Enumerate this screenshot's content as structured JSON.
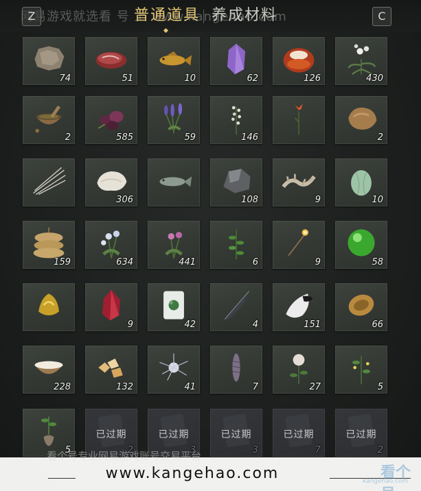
{
  "header": {
    "left_key": "Z",
    "right_key": "C",
    "tabs": [
      {
        "label": "普通道具",
        "active": true
      },
      {
        "label": "养成材料",
        "active": false
      }
    ],
    "watermark": "网易游戏就选看 号 上 www.kangehao.com"
  },
  "inventory": {
    "columns": 6,
    "items": [
      {
        "icon": "animal-hide-icon",
        "count": "74"
      },
      {
        "icon": "raw-meat-icon",
        "count": "51"
      },
      {
        "icon": "golden-carp-icon",
        "count": "10"
      },
      {
        "icon": "amethyst-crystal-icon",
        "count": "62"
      },
      {
        "icon": "red-agate-stone-icon",
        "count": "126"
      },
      {
        "icon": "white-orchid-icon",
        "count": "430"
      },
      {
        "icon": "mortar-and-pestle-icon",
        "count": "2"
      },
      {
        "icon": "purple-flower-bundle-icon",
        "count": "585"
      },
      {
        "icon": "lavender-herb-icon",
        "count": "59"
      },
      {
        "icon": "white-blossom-herb-icon",
        "count": "146"
      },
      {
        "icon": "red-lily-icon",
        "count": ""
      },
      {
        "icon": "fox-fur-icon",
        "count": "2"
      },
      {
        "icon": "porcupine-quills-icon",
        "count": ""
      },
      {
        "icon": "white-fleece-icon",
        "count": "306"
      },
      {
        "icon": "fish-icon",
        "count": ""
      },
      {
        "icon": "iron-ore-icon",
        "count": "108"
      },
      {
        "icon": "bone-fragment-icon",
        "count": "9"
      },
      {
        "icon": "winter-melon-icon",
        "count": "10"
      },
      {
        "icon": "grain-sacks-icon",
        "count": "159"
      },
      {
        "icon": "blue-aster-herb-icon",
        "count": "634"
      },
      {
        "icon": "pink-flower-herb-icon",
        "count": "441"
      },
      {
        "icon": "green-herb-icon",
        "count": "6"
      },
      {
        "icon": "torch-incense-icon",
        "count": "9"
      },
      {
        "icon": "jade-orb-icon",
        "count": "58"
      },
      {
        "icon": "gold-ingot-icon",
        "count": ""
      },
      {
        "icon": "crimson-crystal-icon",
        "count": "9"
      },
      {
        "icon": "jade-plant-jar-icon",
        "count": "42"
      },
      {
        "icon": "dark-feather-icon",
        "count": "4"
      },
      {
        "icon": "white-tail-fur-icon",
        "count": "151"
      },
      {
        "icon": "carved-bronze-ring-icon",
        "count": "66"
      },
      {
        "icon": "milk-bowl-icon",
        "count": "228"
      },
      {
        "icon": "rock-sugar-icon",
        "count": "132"
      },
      {
        "icon": "silver-spider-lily-icon",
        "count": "41"
      },
      {
        "icon": "pine-cone-spike-icon",
        "count": "7"
      },
      {
        "icon": "white-peony-icon",
        "count": "27"
      },
      {
        "icon": "yellow-flower-herb-icon",
        "count": "5"
      },
      {
        "icon": "root-seedling-icon",
        "count": "5"
      },
      {
        "icon": "expired-slip-icon",
        "count": "2",
        "expired_label": "已过期"
      },
      {
        "icon": "expired-slip-icon",
        "count": "3",
        "expired_label": "已过期"
      },
      {
        "icon": "expired-slip-icon",
        "count": "3",
        "expired_label": "已过期"
      },
      {
        "icon": "expired-slip-icon",
        "count": "7",
        "expired_label": "已过期"
      },
      {
        "icon": "expired-slip-icon",
        "count": "2",
        "expired_label": "已过期"
      }
    ]
  },
  "banner": {
    "text": "www.kangehao.com",
    "subtext": "看个号专业网易游戏账号交易平台",
    "logo_text": "看个号",
    "logo_url": "kangehao.com"
  },
  "colors": {
    "active_tab": "#e2c676",
    "inactive_tab": "#c9c9c2",
    "cell_bg": "#383d38",
    "count_text": "#f2f2ee"
  }
}
